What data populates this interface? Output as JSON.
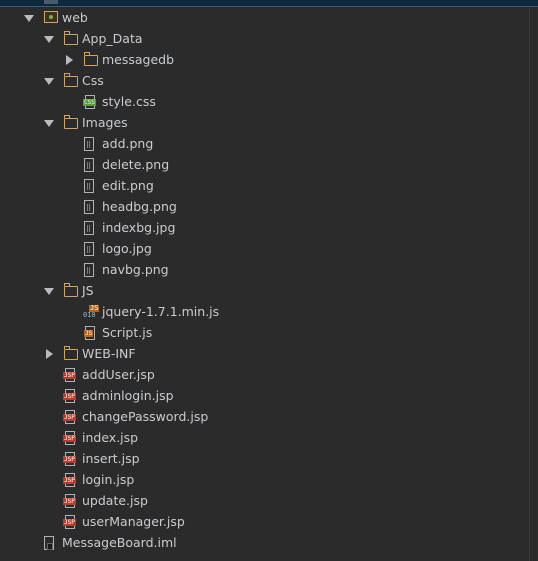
{
  "tree": [
    {
      "label": "web",
      "depth": 1,
      "arrow": "down",
      "icon": "module-folder-icon"
    },
    {
      "label": "App_Data",
      "depth": 2,
      "arrow": "down",
      "icon": "folder-icon"
    },
    {
      "label": "messagedb",
      "depth": 3,
      "arrow": "right",
      "icon": "folder-icon"
    },
    {
      "label": "Css",
      "depth": 2,
      "arrow": "down",
      "icon": "folder-icon"
    },
    {
      "label": "style.css",
      "depth": 3,
      "arrow": "none",
      "icon": "css-file-icon"
    },
    {
      "label": "Images",
      "depth": 2,
      "arrow": "down",
      "icon": "folder-icon"
    },
    {
      "label": "add.png",
      "depth": 3,
      "arrow": "none",
      "icon": "image-file-icon"
    },
    {
      "label": "delete.png",
      "depth": 3,
      "arrow": "none",
      "icon": "image-file-icon"
    },
    {
      "label": "edit.png",
      "depth": 3,
      "arrow": "none",
      "icon": "image-file-icon"
    },
    {
      "label": "headbg.png",
      "depth": 3,
      "arrow": "none",
      "icon": "image-file-icon"
    },
    {
      "label": "indexbg.jpg",
      "depth": 3,
      "arrow": "none",
      "icon": "image-file-icon"
    },
    {
      "label": "logo.jpg",
      "depth": 3,
      "arrow": "none",
      "icon": "image-file-icon"
    },
    {
      "label": "navbg.png",
      "depth": 3,
      "arrow": "none",
      "icon": "image-file-icon"
    },
    {
      "label": "JS",
      "depth": 2,
      "arrow": "down",
      "icon": "folder-icon"
    },
    {
      "label": "jquery-1.7.1.min.js",
      "depth": 3,
      "arrow": "none",
      "icon": "binary-js-file-icon"
    },
    {
      "label": "Script.js",
      "depth": 3,
      "arrow": "none",
      "icon": "js-file-icon"
    },
    {
      "label": "WEB-INF",
      "depth": 2,
      "arrow": "right",
      "icon": "folder-icon"
    },
    {
      "label": "addUser.jsp",
      "depth": 2,
      "arrow": "none",
      "icon": "jsp-file-icon"
    },
    {
      "label": "adminlogin.jsp",
      "depth": 2,
      "arrow": "none",
      "icon": "jsp-file-icon"
    },
    {
      "label": "changePassword.jsp",
      "depth": 2,
      "arrow": "none",
      "icon": "jsp-file-icon"
    },
    {
      "label": "index.jsp",
      "depth": 2,
      "arrow": "none",
      "icon": "jsp-file-icon"
    },
    {
      "label": "insert.jsp",
      "depth": 2,
      "arrow": "none",
      "icon": "jsp-file-icon"
    },
    {
      "label": "login.jsp",
      "depth": 2,
      "arrow": "none",
      "icon": "jsp-file-icon"
    },
    {
      "label": "update.jsp",
      "depth": 2,
      "arrow": "none",
      "icon": "jsp-file-icon"
    },
    {
      "label": "userManager.jsp",
      "depth": 2,
      "arrow": "none",
      "icon": "jsp-file-icon"
    },
    {
      "label": "MessageBoard.iml",
      "depth": 1,
      "arrow": "none",
      "icon": "iml-file-icon"
    }
  ],
  "colors": {
    "background": "#2b2b2b",
    "text": "#c9ccd0",
    "folder": "#cfa55f",
    "selection_bar": "#0d293e"
  }
}
